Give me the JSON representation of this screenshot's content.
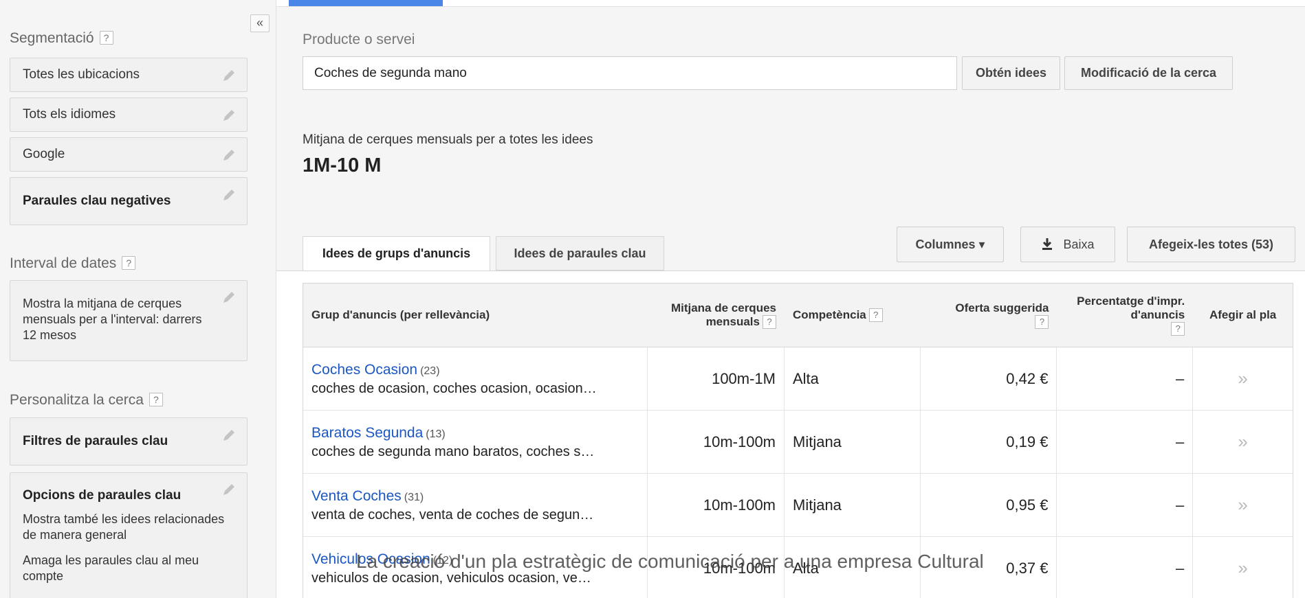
{
  "sidebar": {
    "collapse_label": "«",
    "targeting_title": "Segmentació",
    "targeting_items": [
      {
        "label": "Totes les ubicacions"
      },
      {
        "label": "Tots els idiomes"
      },
      {
        "label": "Google"
      },
      {
        "label": "Paraules clau negatives"
      }
    ],
    "date_range_title": "Interval de dates",
    "date_range_text": "Mostra la mitjana de cerques mensuals per a l'interval: darrers 12 mesos",
    "customize_title": "Personalitza la cerca",
    "keyword_filters_label": "Filtres de paraules clau",
    "keyword_options_label": "Opcions de paraules clau",
    "keyword_options_lines": [
      "Mostra també les idees relacionades de manera general",
      "Amaga les paraules clau al meu compte"
    ],
    "help_glyph": "?"
  },
  "main": {
    "product_label": "Producte o servei",
    "search_value": "Coches de segunda mano",
    "get_ideas_button": "Obtén idees",
    "modify_search_button": "Modificació de la cerca",
    "avg_label": "Mitjana de cerques mensuals per a totes les idees",
    "avg_value": "1M-10 M",
    "tabs": [
      {
        "label": "Idees de grups d'anuncis",
        "active": true
      },
      {
        "label": "Idees de paraules clau",
        "active": false
      }
    ],
    "columns_button": "Columnes ▾",
    "download_button": "Baixa",
    "add_all_button": "Afegeix-les totes (53)"
  },
  "table": {
    "headers": {
      "group": "Grup d'anuncis (per rellevància)",
      "avg_searches": "Mitjana de cerques mensuals",
      "competition": "Competència",
      "suggested_bid": "Oferta suggerida",
      "impr_share": "Percentatge d'impr. d'anuncis",
      "add_to_plan": "Afegir al pla"
    },
    "rows": [
      {
        "name": "Coches Ocasion",
        "count": "(23)",
        "keywords": "coches de ocasion, coches ocasion, ocasion…",
        "avg": "100m-1M",
        "competition": "Alta",
        "bid": "0,42 €",
        "share": "–",
        "add": "»"
      },
      {
        "name": "Baratos Segunda",
        "count": "(13)",
        "keywords": "coches de segunda mano baratos, coches s…",
        "avg": "10m-100m",
        "competition": "Mitjana",
        "bid": "0,19 €",
        "share": "–",
        "add": "»"
      },
      {
        "name": "Venta Coches",
        "count": "(31)",
        "keywords": "venta de coches, venta de coches de segun…",
        "avg": "10m-100m",
        "competition": "Mitjana",
        "bid": "0,95 €",
        "share": "–",
        "add": "»"
      },
      {
        "name": "Vehiculos Ocasion",
        "count": "(12)",
        "keywords": "vehiculos de ocasion, vehiculos ocasion, ve…",
        "avg": "10m-100m",
        "competition": "Alta",
        "bid": "0,37 €",
        "share": "–",
        "add": "»"
      }
    ]
  },
  "caption": "La creació d'un pla estratègic de comunicació per a una empresa Cultural"
}
